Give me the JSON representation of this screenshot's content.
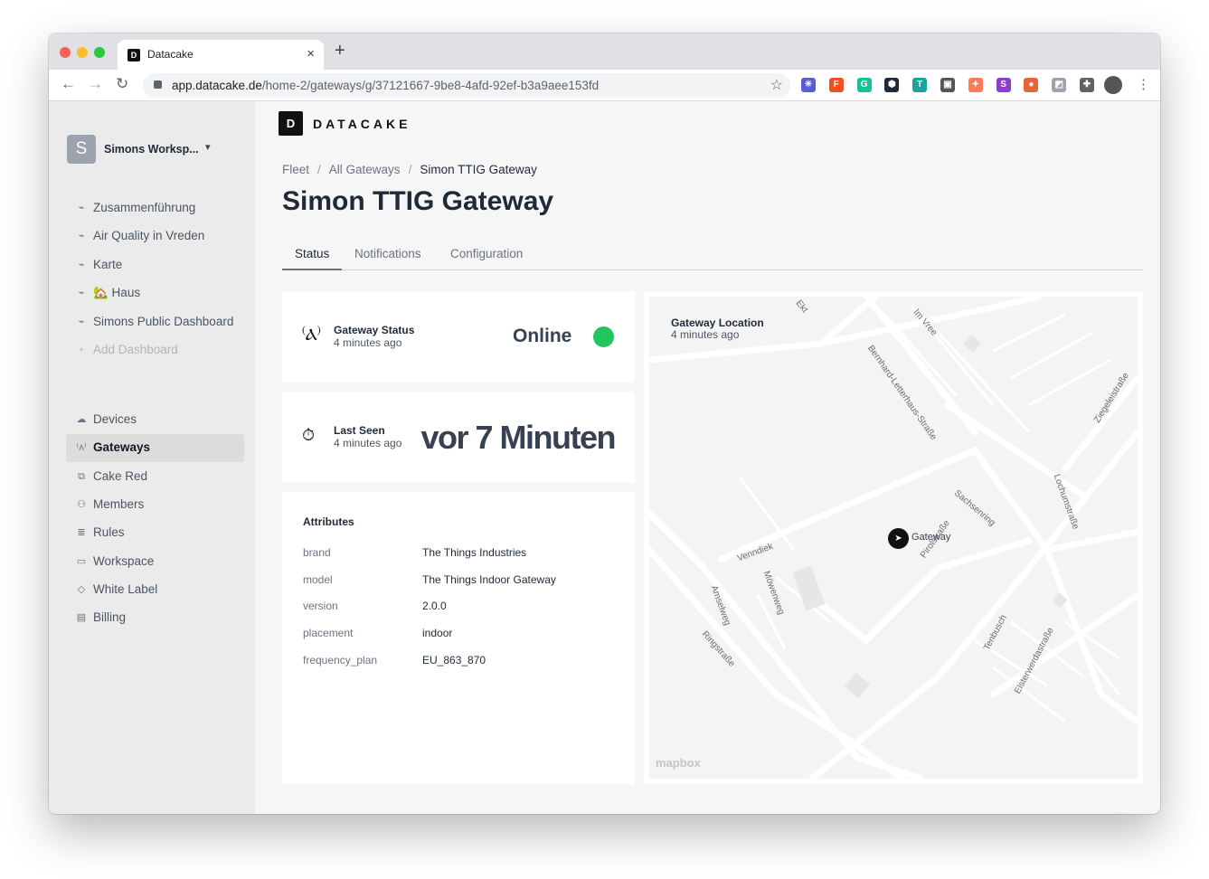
{
  "browser": {
    "tab_title": "Datacake",
    "tab_close": "×",
    "new_tab": "+",
    "url_host": "app.datacake.de",
    "url_path": "/home-2/gateways/g/37121667-9be8-4afd-92ef-b3a9aee153fd",
    "extensions": [
      {
        "name": "snowflake-icon",
        "color": "#5b5bd6",
        "glyph": "✳"
      },
      {
        "name": "figma-icon",
        "color": "#f24e1e",
        "glyph": "F"
      },
      {
        "name": "grammarly-icon",
        "color": "#15c39a",
        "glyph": "G"
      },
      {
        "name": "hexagon-icon",
        "color": "#1e293b",
        "glyph": "⬢"
      },
      {
        "name": "t-extension-icon",
        "color": "#1ba39c",
        "glyph": "T"
      },
      {
        "name": "dark-extension-icon",
        "color": "#555555",
        "glyph": "▣"
      },
      {
        "name": "hubspot-icon",
        "color": "#ff7a59",
        "glyph": "✦"
      },
      {
        "name": "s-extension-icon",
        "color": "#8b3fc7",
        "glyph": "S"
      },
      {
        "name": "pill-extension-icon",
        "color": "#e5663b",
        "glyph": "●"
      },
      {
        "name": "gray-extension-icon",
        "color": "#9ca3af",
        "glyph": "◩"
      },
      {
        "name": "puzzle-icon",
        "color": "#5f6368",
        "glyph": "✚"
      }
    ]
  },
  "brand": {
    "logo_glyph": "D",
    "name": "DATACAKE"
  },
  "workspace": {
    "initial": "S",
    "name": "Simons Worksp..."
  },
  "sidebar": {
    "dashboards": [
      {
        "label": "Zusammenführung",
        "name": "sidebar-item-zusammenfuehrung",
        "icon": "chart-icon"
      },
      {
        "label": "Air Quality in Vreden",
        "name": "sidebar-item-air-quality",
        "icon": "chart-icon"
      },
      {
        "label": "Karte",
        "name": "sidebar-item-karte",
        "icon": "chart-icon"
      },
      {
        "label": "🏡 Haus",
        "name": "sidebar-item-haus",
        "icon": "chart-icon"
      },
      {
        "label": "Simons Public Dashboard",
        "name": "sidebar-item-public-dashboard",
        "icon": "chart-icon"
      }
    ],
    "add_dashboard": "Add Dashboard",
    "nav": [
      {
        "label": "Devices",
        "name": "sidebar-item-devices",
        "icon": "cloud-icon"
      },
      {
        "label": "Gateways",
        "name": "sidebar-item-gateways",
        "icon": "antenna-icon",
        "active": true
      },
      {
        "label": "Cake Red",
        "name": "sidebar-item-cake-red",
        "icon": "flow-icon"
      },
      {
        "label": "Members",
        "name": "sidebar-item-members",
        "icon": "users-icon"
      },
      {
        "label": "Rules",
        "name": "sidebar-item-rules",
        "icon": "rules-icon"
      },
      {
        "label": "Workspace",
        "name": "sidebar-item-workspace",
        "icon": "workspace-icon"
      },
      {
        "label": "White Label",
        "name": "sidebar-item-white-label",
        "icon": "tag-icon"
      },
      {
        "label": "Billing",
        "name": "sidebar-item-billing",
        "icon": "billing-icon"
      }
    ]
  },
  "breadcrumb": {
    "fleet": "Fleet",
    "sep": "/",
    "all": "All Gateways",
    "current": "Simon TTIG Gateway"
  },
  "page_title": "Simon TTIG Gateway",
  "tabs": {
    "status": "Status",
    "notifications": "Notifications",
    "configuration": "Configuration"
  },
  "status_card": {
    "label": "Gateway Status",
    "sub": "4 minutes ago",
    "value": "Online",
    "status_color": "#22c55e"
  },
  "seen_card": {
    "label": "Last Seen",
    "sub": "4 minutes ago",
    "value": "vor 7 Minuten"
  },
  "attributes": {
    "title": "Attributes",
    "rows": [
      {
        "key": "brand",
        "value": "The Things Industries"
      },
      {
        "key": "model",
        "value": "The Things Indoor Gateway"
      },
      {
        "key": "version",
        "value": "2.0.0"
      },
      {
        "key": "placement",
        "value": "indoor"
      },
      {
        "key": "frequency_plan",
        "value": "EU_863_870"
      }
    ]
  },
  "map": {
    "title": "Gateway Location",
    "sub": "4 minutes ago",
    "marker_label": "Gateway",
    "attribution": "mapbox",
    "streets": [
      "Ekt",
      "Im Vree",
      "Bernhard-Letterhaus-Straße",
      "Ziegeleistraße",
      "Sachsenring",
      "Lochumstraße",
      "Venndiek",
      "Pirolstraße",
      "Möwenweg",
      "Amselweg",
      "Ringstraße",
      "Tenbusch",
      "Elsterwerdastraße"
    ]
  }
}
